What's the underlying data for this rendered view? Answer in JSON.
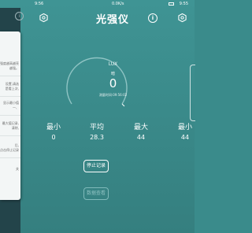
{
  "status_bar": {
    "time_left": "9:56",
    "time_right": "9:55",
    "network": "0.0K/s"
  },
  "header": {
    "title": "光强仪"
  },
  "gauge": {
    "unit": "LUX",
    "brightness_label": "暗",
    "value": "0",
    "timestamp": "测量时间:09:56:02"
  },
  "stats": {
    "min_label": "最小",
    "min_value": "0",
    "avg_label": "平均",
    "avg_value": "28.3",
    "max_label": "最大",
    "max_value": "44",
    "min2_label": "最小",
    "min2_value": "44"
  },
  "buttons": {
    "stop_label": "停止记录",
    "data_label": "数据查看"
  },
  "drawer": {
    "items": [
      "强度越高越亮,",
      "越强。",
      "设置,请选",
      "是看上次,",
      "显示最小值",
      "一、",
      "最大值记录,",
      "清除,",
      "后,",
      "点击停止记录",
      "关"
    ]
  },
  "colors": {
    "background": "#3a8b8b",
    "rail": "#23444a",
    "drawer": "#f3f6f6"
  }
}
